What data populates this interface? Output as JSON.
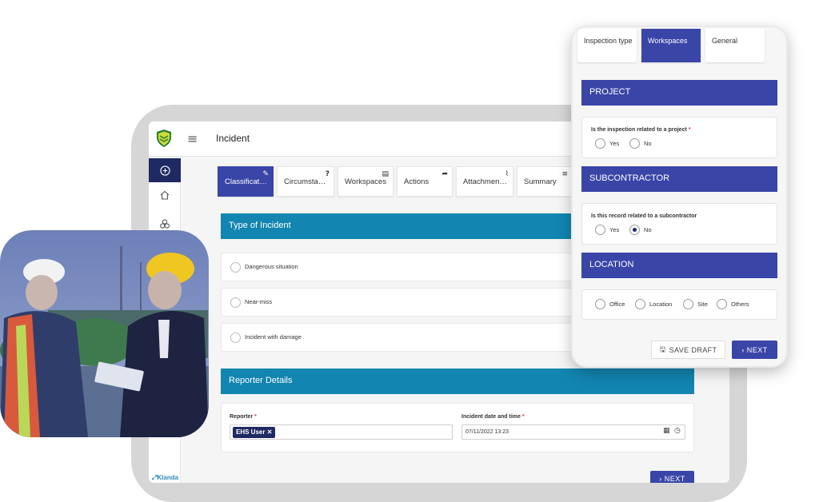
{
  "app": {
    "title": "Incident",
    "brand": "Klanda"
  },
  "colors": {
    "primary": "#3a45a8",
    "section_header": "#1285b0",
    "navy": "#1f2a63",
    "required": "#dd3333"
  },
  "tabs": [
    {
      "label": "Classificat…",
      "icon": "edit-icon",
      "active": true
    },
    {
      "label": "Circumsta…",
      "icon": "question-icon"
    },
    {
      "label": "Workspaces",
      "icon": "building-icon"
    },
    {
      "label": "Actions",
      "icon": "share-arrow-icon"
    },
    {
      "label": "Attachmen…",
      "icon": "paperclip-icon"
    },
    {
      "label": "Summary",
      "icon": "list-icon"
    }
  ],
  "incident_type": {
    "header": "Type of Incident",
    "options": [
      "Dangerous situation",
      "Near-miss",
      "Incident with damage"
    ]
  },
  "reporter": {
    "header": "Reporter Details",
    "reporter_label": "Reporter",
    "reporter_value": "EHS User",
    "date_label": "Incident date and time",
    "date_value": "07/11/2022 13:23",
    "required_mark": "*"
  },
  "next_label": "NEXT",
  "phone": {
    "tabs": [
      {
        "label": "Inspection type"
      },
      {
        "label": "Workspaces",
        "active": true
      },
      {
        "label": "General"
      }
    ],
    "project": {
      "header": "PROJECT",
      "question": "Is the inspection related to a project",
      "options": [
        "Yes",
        "No"
      ]
    },
    "subcontractor": {
      "header": "SUBCONTRACTOR",
      "question": "Is this record related to a subcontractor",
      "options": [
        "Yes",
        "No"
      ],
      "selected": "No"
    },
    "location": {
      "header": "LOCATION",
      "options": [
        "Office",
        "Location",
        "Site",
        "Others"
      ]
    },
    "save_draft_label": "SAVE DRAFT",
    "next_label": "NEXT"
  }
}
